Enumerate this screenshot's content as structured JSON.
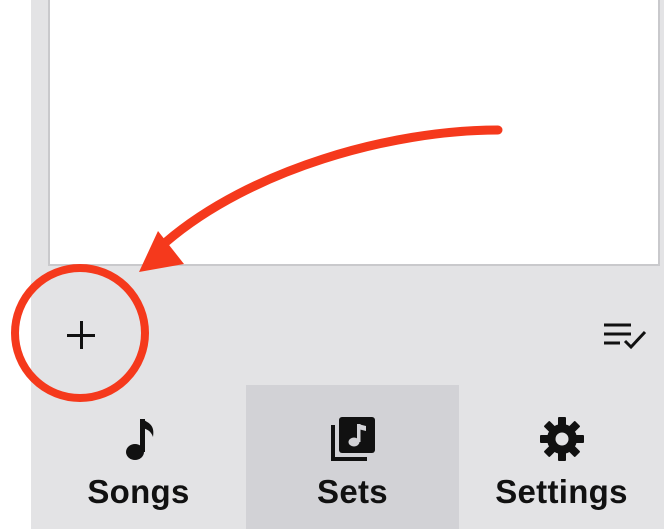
{
  "tabs": [
    {
      "label": "Songs",
      "icon": "music-note-icon",
      "selected": false
    },
    {
      "label": "Sets",
      "icon": "music-library-icon",
      "selected": true
    },
    {
      "label": "Settings",
      "icon": "gear-icon",
      "selected": false
    }
  ],
  "toolbar": {
    "add_icon": "plus-icon",
    "edit_icon": "list-check-icon"
  },
  "annotation": {
    "color": "#f5391c",
    "shapes": [
      "curved-arrow",
      "circle"
    ]
  },
  "colors": {
    "background": "#e3e3e5",
    "selected_tab": "#d2d2d6",
    "content": "#ffffff",
    "icon": "#111111"
  }
}
